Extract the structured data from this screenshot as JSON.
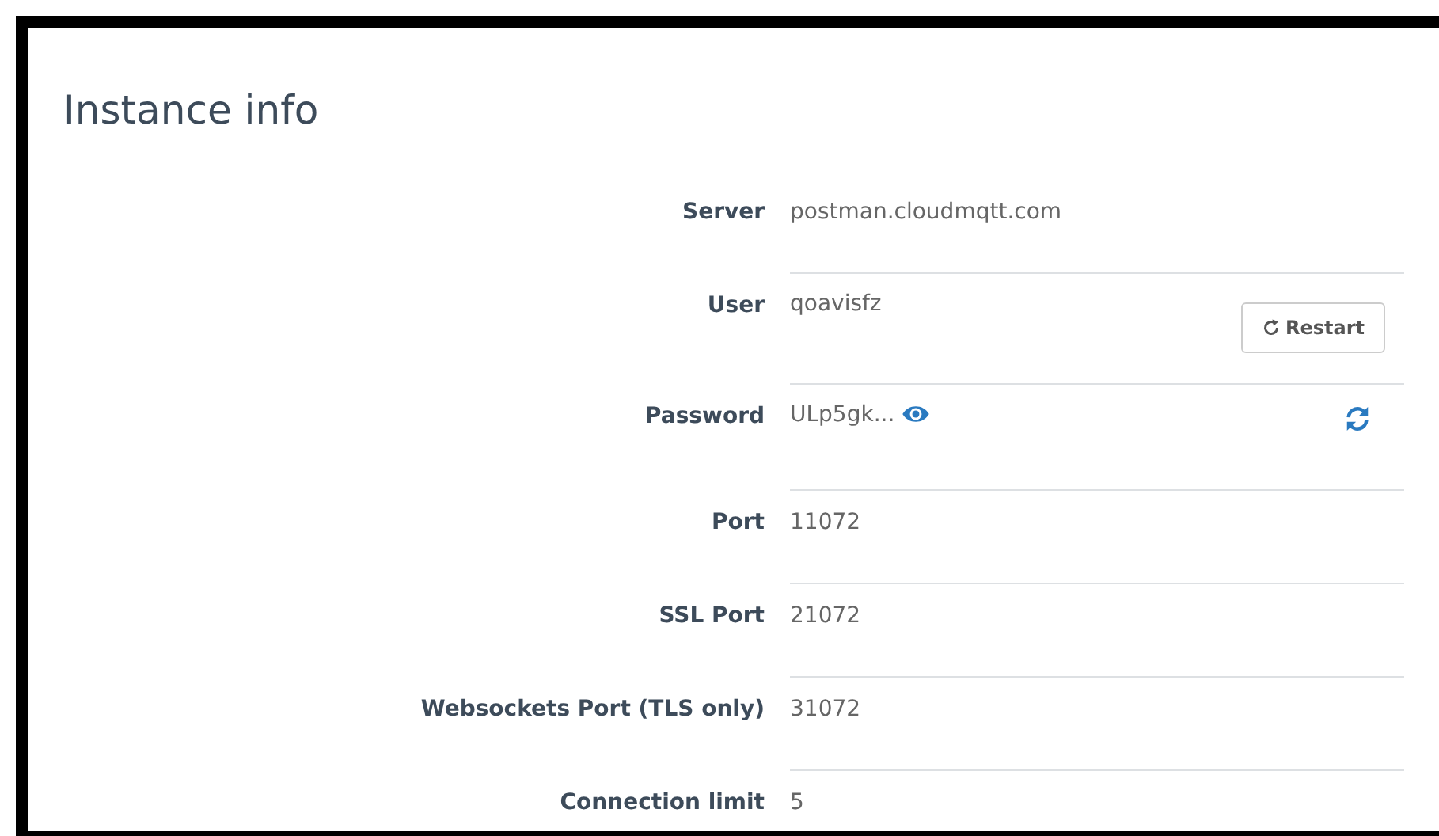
{
  "title": "Instance info",
  "rows": [
    {
      "label": "Server",
      "value": "postman.cloudmqtt.com"
    },
    {
      "label": "User",
      "value": "qoavisfz",
      "action": {
        "kind": "button",
        "label": "Restart"
      }
    },
    {
      "label": "Password",
      "value": "ULp5gk...",
      "reveal": true,
      "action": {
        "kind": "refresh"
      }
    },
    {
      "label": "Port",
      "value": "11072"
    },
    {
      "label": "SSL Port",
      "value": "21072"
    },
    {
      "label": "Websockets Port (TLS only)",
      "value": "31072"
    },
    {
      "label": "Connection limit",
      "value": "5"
    }
  ]
}
